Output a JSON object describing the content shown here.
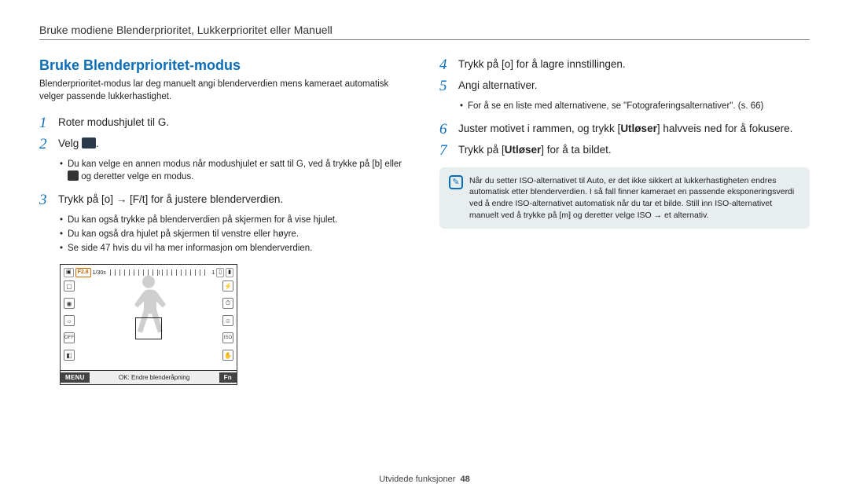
{
  "header": {
    "title": "Bruke modiene Blenderprioritet, Lukkerprioritet eller Manuell"
  },
  "section": {
    "title": "Bruke Blenderprioritet-modus",
    "intro": "Blenderprioritet-modus lar deg manuelt angi blenderverdien mens kameraet automatisk velger passende lukkerhastighet."
  },
  "steps_left": {
    "s1_pre": "Roter modushjulet til ",
    "s1_glyph": "G",
    "s1_post": ".",
    "s2_pre": "Velg ",
    "s2_post": ".",
    "s2_sub_a_pre": "Du kan velge en annen modus når modushjulet er satt til ",
    "s2_sub_a_mid": ", ved å trykke på [",
    "s2_sub_a_b": "b",
    "s2_sub_a_or": "] eller ",
    "s2_sub_a_end": " og deretter velge en modus.",
    "s3_pre": "Trykk på [",
    "s3_o": "o",
    "s3_arrow": "] → [",
    "s3_ft": "F/t",
    "s3_post": "] for å justere blenderverdien.",
    "s3_b1": "Du kan også trykke på blenderverdien på skjermen for å vise hjulet.",
    "s3_b2": "Du kan også dra hjulet på skjermen til venstre eller høyre.",
    "s3_b3": "Se side 47 hvis du vil ha mer informasjon om blenderverdien."
  },
  "lcd": {
    "aperture": "F2.8",
    "shutter": "1/30s",
    "right_count": "1",
    "menu": "MENU",
    "mid": "OK: Endre blenderåpning",
    "fn": "Fn"
  },
  "steps_right": {
    "s4_pre": "Trykk på [",
    "s4_o": "o",
    "s4_post": "] for å lagre innstillingen.",
    "s5": "Angi alternativer.",
    "s5_b1": "For å se en liste med alternativene, se \"Fotograferingsalternativer\". (s. 66)",
    "s6_pre": "Juster motivet i rammen, og trykk [",
    "s6_bold": "Utløser",
    "s6_post": "] halvveis ned for å fokusere.",
    "s7_pre": "Trykk på [",
    "s7_bold": "Utløser",
    "s7_post": "] for å ta bildet."
  },
  "note": {
    "text_a": "Når du setter ISO-alternativet til ",
    "auto": "Auto",
    "text_b": ", er det ikke sikkert at lukkerhastigheten endres automatisk etter blenderverdien. I så fall finner kameraet en passende eksponeringsverdi ved å endre ISO-alternativet automatisk når du tar et bilde. Still inn ISO-alternativet manuelt ved å trykke på [",
    "m": "m",
    "text_c": "] og deretter velge ",
    "iso": "ISO",
    "text_d": " → et alternativ."
  },
  "footer": {
    "section": "Utvidede funksjoner",
    "page": "48"
  }
}
